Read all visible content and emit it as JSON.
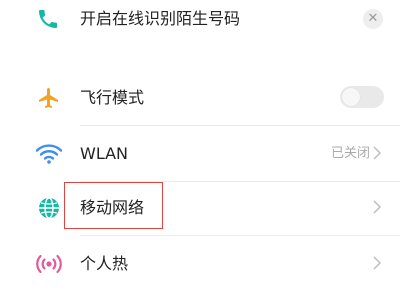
{
  "banner": {
    "text": "开启在线识别陌生号码",
    "close_icon": "close-icon"
  },
  "settings": {
    "items": [
      {
        "label": "飞行模式",
        "icon": "airplane-icon",
        "toggle_on": false
      },
      {
        "label": "WLAN",
        "icon": "wifi-icon",
        "status": "已关闭"
      },
      {
        "label": "移动网络",
        "icon": "globe-icon"
      },
      {
        "label": "个人热",
        "icon": "hotspot-icon"
      }
    ]
  },
  "colors": {
    "accent_teal": "#15b9a3",
    "airplane_orange": "#f5a21f",
    "wifi_blue": "#3e8ef0",
    "highlight_red": "#e0463f"
  }
}
